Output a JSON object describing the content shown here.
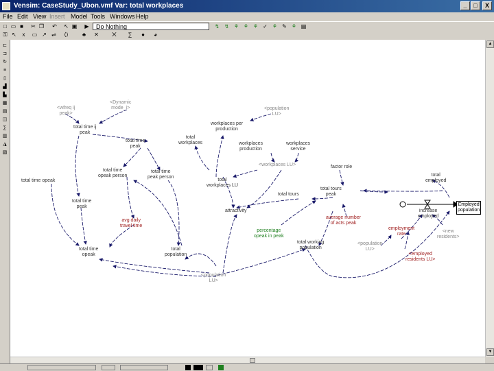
{
  "window": {
    "title": "Vensim: CaseStudy_Ubon.vmf Var: total workplaces",
    "buttons": {
      "minimize": "_",
      "maximize": "□",
      "close": "X"
    }
  },
  "menu": {
    "items": [
      "File",
      "Edit",
      "View",
      "Insert",
      "Model",
      "Tools",
      "Windows",
      "Help"
    ]
  },
  "toolbar": {
    "sim_combo_value": "Do Nothing"
  },
  "diagram": {
    "nodes": [
      {
        "id": "wfreq",
        "text": "<wfreq ij\npeak>",
        "style": "gray"
      },
      {
        "id": "dynmode",
        "text": "<Dynamic\nmode_i>",
        "style": "gray"
      },
      {
        "id": "tt_peak",
        "text": "total time ij\npeak",
        "style": "dark"
      },
      {
        "id": "pop_lu_top",
        "text": "<population\nLU>",
        "style": "gray"
      },
      {
        "id": "wp_per_prod",
        "text": "workplaces per\nproduction",
        "style": "dark"
      },
      {
        "id": "total_wp",
        "text": "total\nworkplaces",
        "style": "dark"
      },
      {
        "id": "wp_prod",
        "text": "workplaces\nproduction",
        "style": "dark"
      },
      {
        "id": "wp_service",
        "text": "workplaces\nservice",
        "style": "dark"
      },
      {
        "id": "wp_lu",
        "text": "<workplaces LU>",
        "style": "gray"
      },
      {
        "id": "total_time_peak",
        "text": "total time\npeak",
        "style": "dark"
      },
      {
        "id": "tt_per_peak",
        "text": "total time\npeak person",
        "style": "dark"
      },
      {
        "id": "tt_opeak_person",
        "text": "total time\nopeak person",
        "style": "dark"
      },
      {
        "id": "tt_opeak_left",
        "text": "total time opeak",
        "style": "dark"
      },
      {
        "id": "total_wp_lu",
        "text": "total\nworkplaces LU",
        "style": "dark"
      },
      {
        "id": "factor",
        "text": "factor role",
        "style": "dark"
      },
      {
        "id": "total_tours_peak",
        "text": "total tours\npeak",
        "style": "dark"
      },
      {
        "id": "total_tours",
        "text": "total tours",
        "style": "dark"
      },
      {
        "id": "total_employed",
        "text": "total\nemployed",
        "style": "dark"
      },
      {
        "id": "employed_pop",
        "text": "Employed\npopulation",
        "style": "box"
      },
      {
        "id": "tt_peak2",
        "text": "total time\npeak",
        "style": "dark"
      },
      {
        "id": "daily_trips",
        "text": "avg daily\ntravel time",
        "style": "red"
      },
      {
        "id": "attractivity",
        "text": "attractivity",
        "style": "dark"
      },
      {
        "id": "avg_acts",
        "text": "average number\nof acts peak",
        "style": "red"
      },
      {
        "id": "increase_emp",
        "text": "increase\nemployed",
        "style": "dark"
      },
      {
        "id": "emp_share",
        "text": "employment\nrate",
        "style": "red"
      },
      {
        "id": "new_residents",
        "text": "<new\nresidents>",
        "style": "gray"
      },
      {
        "id": "pct_opeak",
        "text": "percentage\nopeak in peak",
        "style": "green"
      },
      {
        "id": "total_time_opeak",
        "text": "total time\nopeak",
        "style": "dark"
      },
      {
        "id": "total_pop",
        "text": "total\npopulation",
        "style": "dark"
      },
      {
        "id": "working_pop",
        "text": "total working\npopulation",
        "style": "dark"
      },
      {
        "id": "pop_tt",
        "text": "<population\nLU>",
        "style": "gray"
      },
      {
        "id": "emp_rate_lu",
        "text": "<employed\nresidents LU>",
        "style": "red"
      },
      {
        "id": "pop_lu_bottom",
        "text": "<population\nLU>",
        "style": "gray"
      }
    ]
  }
}
